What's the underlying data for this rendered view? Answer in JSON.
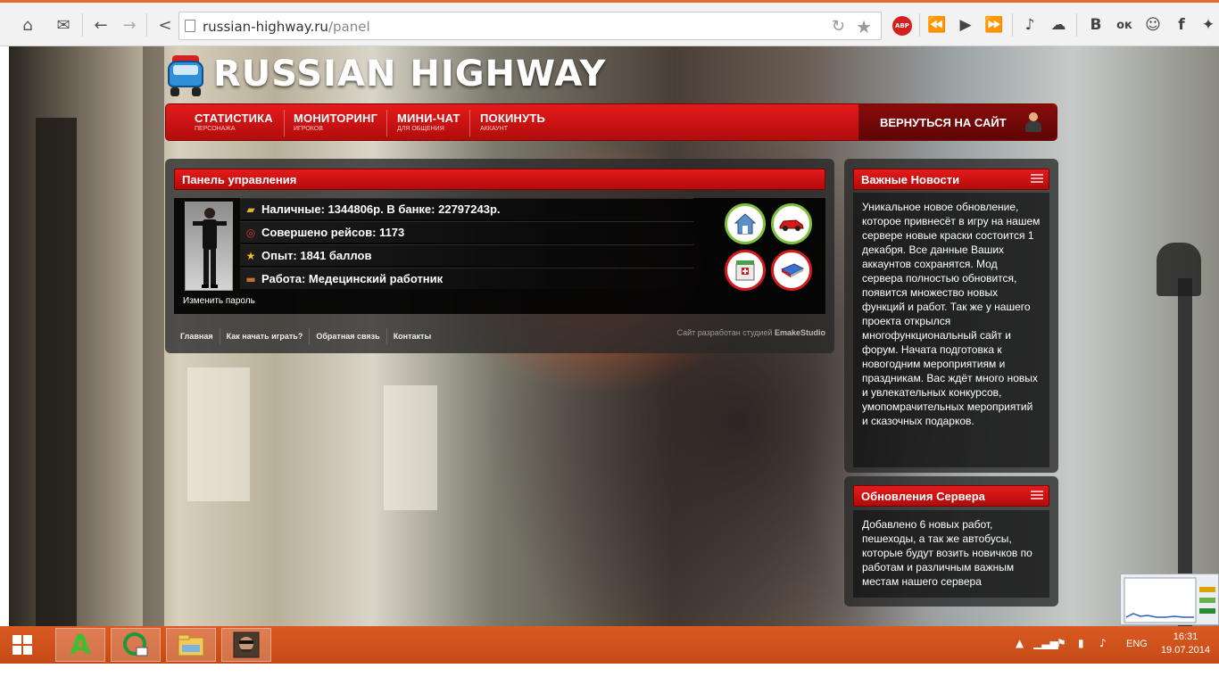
{
  "browser": {
    "url_host": "russian-highway.ru",
    "url_path": "/panel",
    "abp_label": "ABP",
    "ext_vk": "B",
    "ext_ok": "ок",
    "ext_fb": "f"
  },
  "site": {
    "logo_text": "RUSSIAN HIGHWAY",
    "menu": [
      {
        "title": "СТАТИСТИКА",
        "sub": "ПЕРСОНАЖА"
      },
      {
        "title": "МОНИТОРИНГ",
        "sub": "ИГРОКОВ"
      },
      {
        "title": "МИНИ-ЧАТ",
        "sub": "ДЛЯ ОБЩЕНИЯ"
      },
      {
        "title": "ПОКИНУТЬ",
        "sub": "АККАУНТ"
      }
    ],
    "back_to_site": "ВЕРНУТЬСЯ НА САЙТ"
  },
  "panel": {
    "title": "Панель управления",
    "stats": [
      {
        "icon": "coins-icon",
        "text": "Наличные: 1344806р. В банке: 22797243р."
      },
      {
        "icon": "steering-wheel-icon",
        "text": "Совершено рейсов: 1173"
      },
      {
        "icon": "star-icon",
        "text": "Опыт: 1841 баллов"
      },
      {
        "icon": "briefcase-icon",
        "text": "Работа: Медецинский работник"
      }
    ],
    "change_password": "Изменить пароль",
    "footer_links": [
      "Главная",
      "Как начать играть?",
      "Обратная связь",
      "Контакты"
    ],
    "credits_prefix": "Сайт разработан студией ",
    "credits_studio": "EmakeStudio"
  },
  "news": {
    "title": "Важные Новости",
    "body": "Уникальное новое обновление, которое привнесёт в игру на нашем сервере новые краски состоится 1 декабря. Все данные Ваших аккаунтов сохранятся. Мод сервера полностью обновится, появится множество новых функций и работ. Так же у нашего проекта открылся многофункциональный сайт и форум. Начата подготовка к новогодним мероприятиям и праздникам. Вас ждёт много новых и увлекательных конкурсов, умопомрачительных мероприятий и сказочных подарков."
  },
  "updates": {
    "title": "Обновления Сервера",
    "body": "Добавлено 6 новых работ, пешеходы, а так же автобусы, которые будут возить новичков по работам и различным важным местам нашего сервера"
  },
  "taskbar": {
    "lang": "ENG",
    "time": "16:31",
    "date": "19.07.2014"
  },
  "colors": {
    "accent_red": "#d01414",
    "taskbar_orange": "#d2541c",
    "green_ring": "#7ec03a"
  }
}
